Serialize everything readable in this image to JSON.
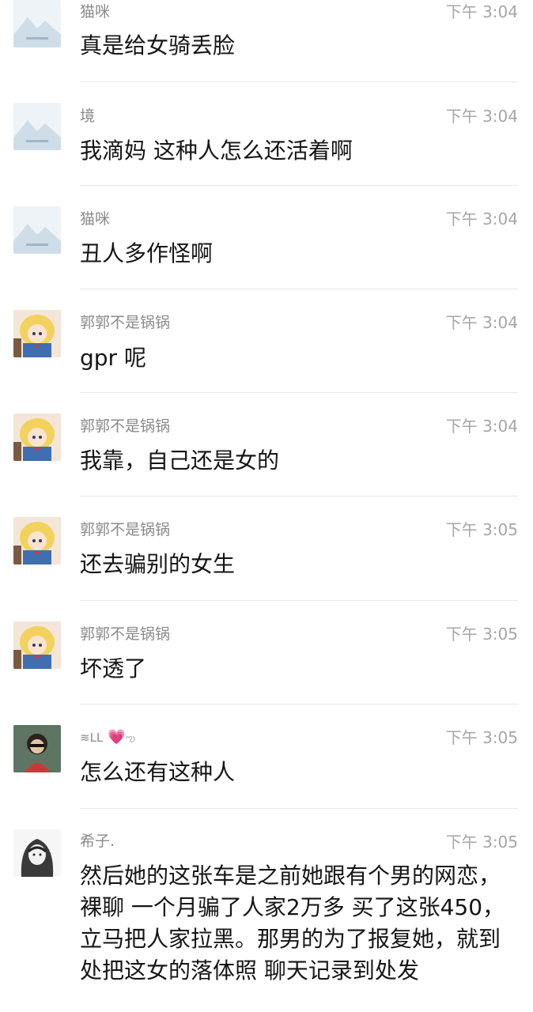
{
  "colors": {
    "name": "#8a8a8a",
    "time": "#a6a6a6",
    "text": "#151515",
    "divider": "#e6e6e6"
  },
  "messages": [
    {
      "name": "猫咪",
      "time": "下午 3:04",
      "text": "真是给女骑丢脸",
      "avatar": "placeholder-image-icon"
    },
    {
      "name": "境",
      "time": "下午 3:04",
      "text": "我滴妈 这种人怎么还活着啊",
      "avatar": "placeholder-image-icon"
    },
    {
      "name": "猫咪",
      "time": "下午 3:04",
      "text": "丑人多作怪啊",
      "avatar": "placeholder-image-icon"
    },
    {
      "name": "郭郭不是锅锅",
      "time": "下午 3:04",
      "text": "gpr 呢",
      "avatar": "anime-girl-avatar"
    },
    {
      "name": "郭郭不是锅锅",
      "time": "下午 3:04",
      "text": "我靠，自己还是女的",
      "avatar": "anime-girl-avatar"
    },
    {
      "name": "郭郭不是锅锅",
      "time": "下午 3:05",
      "text": "还去骗别的女生",
      "avatar": "anime-girl-avatar"
    },
    {
      "name": "郭郭不是锅锅",
      "time": "下午 3:05",
      "text": "坏透了",
      "avatar": "anime-girl-avatar"
    },
    {
      "name": "LL",
      "time": "下午 3:05",
      "text": "怎么还有这种人",
      "avatar": "girl-sunglasses-avatar"
    },
    {
      "name": "希子.",
      "time": "下午 3:05",
      "text": "然后她的这张车是之前她跟有个男的网恋，裸聊 一个月骗了人家2万多 买了这张450，立马把人家拉黑。那男的为了报复她，就到处把这女的落体照 聊天记录到处发",
      "avatar": "sketch-girl-avatar"
    }
  ]
}
